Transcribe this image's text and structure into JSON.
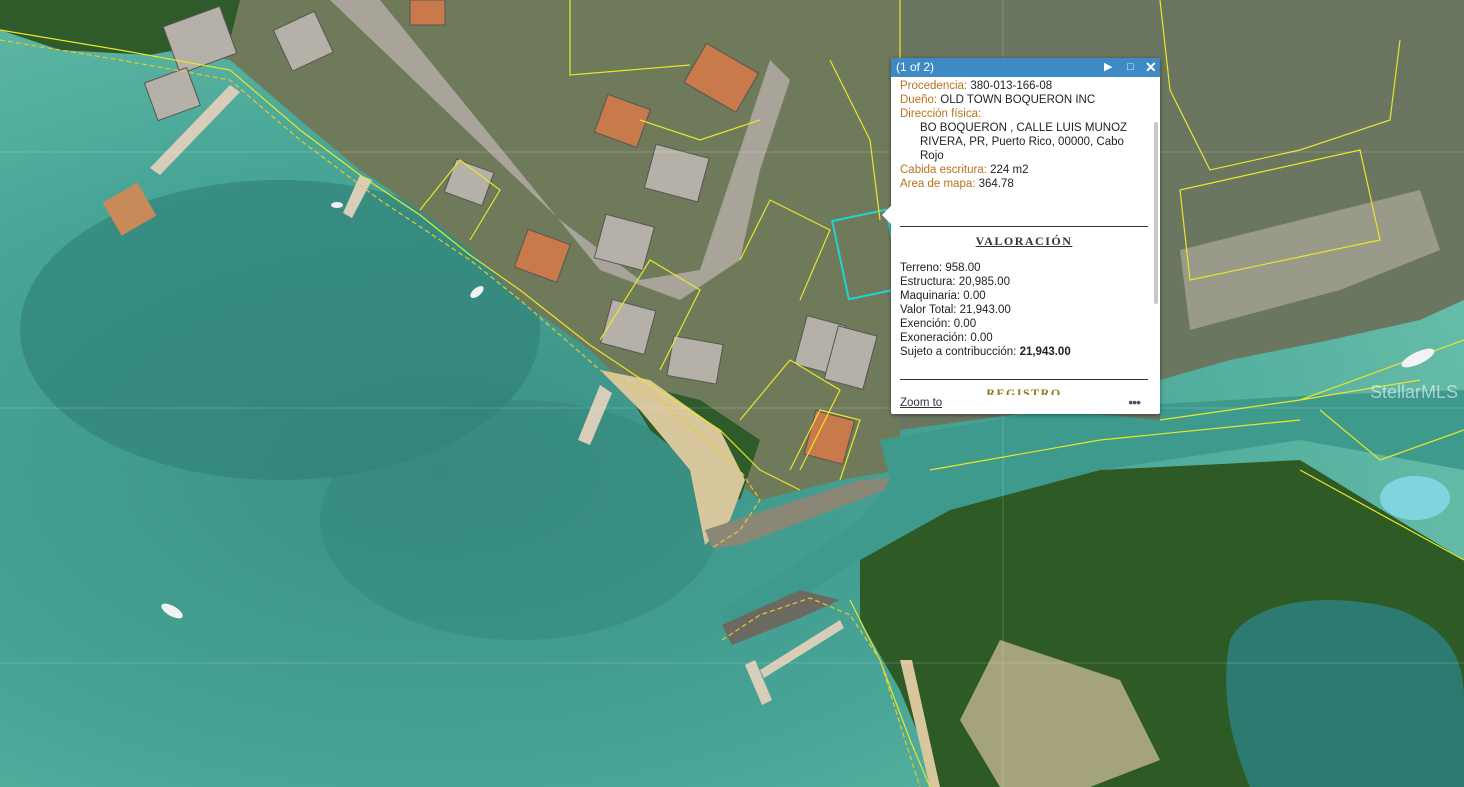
{
  "map": {
    "watermark": "StellarMLS"
  },
  "popup": {
    "counter": "(1 of 2)",
    "fields": [
      {
        "label": "Procedencia:",
        "value": " 380-013-166-08"
      },
      {
        "label": "Dueño:",
        "value": " OLD TOWN BOQUERON INC"
      },
      {
        "label": "Dirección física:",
        "value": ""
      }
    ],
    "address": "BO BOQUERON , CALLE LUIS MUNOZ RIVERA, PR, Puerto Rico, 00000, Cabo Rojo",
    "fields2": [
      {
        "label": "Cabida escritura:",
        "value": " 224 m2"
      },
      {
        "label": "Area de mapa:",
        "value": " 364.78"
      }
    ],
    "valoracion_title": "VALORACIÓN",
    "valoracion": [
      {
        "label": "Terreno:",
        "value": " 958.00"
      },
      {
        "label": "Estructura:",
        "value": " 20,985.00"
      },
      {
        "label": "Maquinaria:",
        "value": " 0.00"
      },
      {
        "label": "Valor Total:",
        "value": " 21,943.00"
      },
      {
        "label": "Exención:",
        "value": " 0.00"
      },
      {
        "label": "Exoneración:",
        "value": " 0.00"
      }
    ],
    "sujeto_label": "Sujeto a contribucción:",
    "sujeto_value": "21,943.00",
    "registro_title": "REGISTRO",
    "zoom_to": "Zoom to",
    "more": "•••"
  }
}
